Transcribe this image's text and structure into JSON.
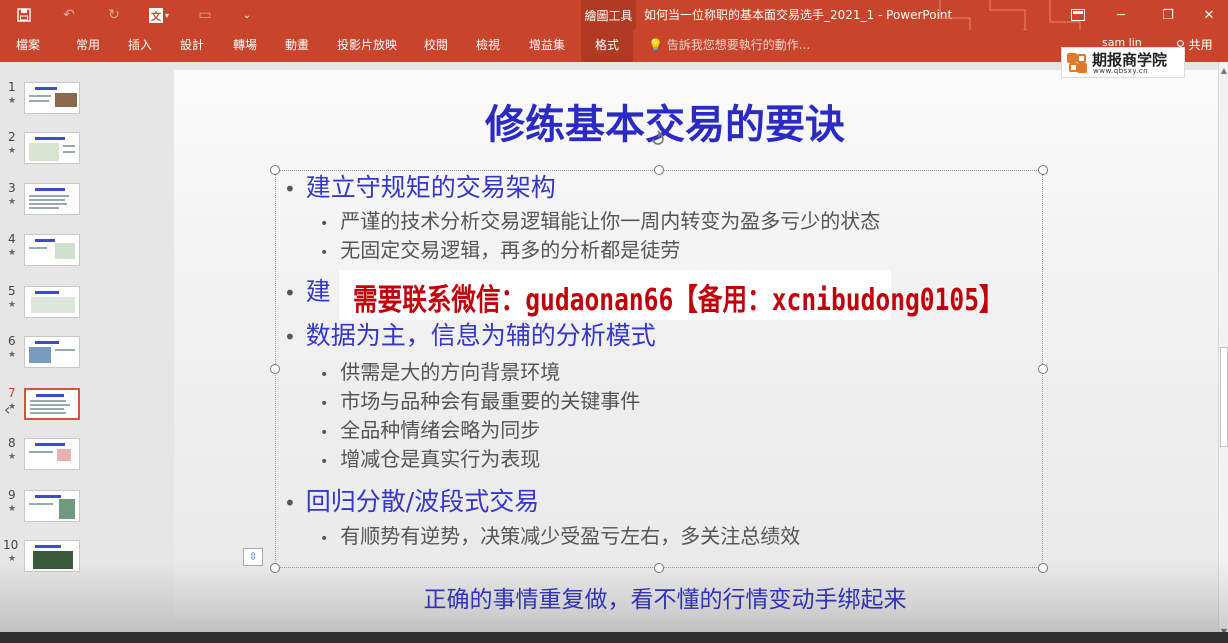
{
  "titlebar": {
    "quick_access": [
      {
        "name": "save-icon",
        "glyph": "🖫"
      },
      {
        "name": "undo-icon",
        "glyph": "↶"
      },
      {
        "name": "redo-icon",
        "glyph": "↻"
      },
      {
        "name": "language-icon",
        "glyph": "文"
      },
      {
        "name": "slideshow-start-icon",
        "glyph": "▭"
      },
      {
        "name": "customize-qat-icon",
        "glyph": "⌄"
      }
    ],
    "tool_context": "繪圖工具",
    "doc_title": "如何当一位称职的基本面交易选手_2021_1 - PowerPoint",
    "window_buttons": [
      {
        "name": "ribbon-display-options-icon",
        "glyph": "▣"
      },
      {
        "name": "minimize-icon",
        "glyph": "─"
      },
      {
        "name": "restore-icon",
        "glyph": "❐"
      },
      {
        "name": "close-icon",
        "glyph": "✕"
      }
    ]
  },
  "ribbon": {
    "tabs": [
      "檔案",
      "常用",
      "插入",
      "設計",
      "轉場",
      "動畫",
      "投影片放映",
      "校閱",
      "檢視",
      "增益集",
      "格式"
    ],
    "active_tab": "格式",
    "tell_me": "告訴我您想要執行的動作...",
    "user": "sam lin",
    "share": "共用"
  },
  "watermark": {
    "name": "期报商学院",
    "url": "www.qbsxy.cn"
  },
  "thumbnails": [
    {
      "num": "1",
      "star": "★"
    },
    {
      "num": "2",
      "star": "★"
    },
    {
      "num": "3",
      "star": "★"
    },
    {
      "num": "4",
      "star": "★"
    },
    {
      "num": "5",
      "star": "★"
    },
    {
      "num": "6",
      "star": "★"
    },
    {
      "num": "7",
      "star": "★",
      "selected": true
    },
    {
      "num": "8",
      "star": "★"
    },
    {
      "num": "9",
      "star": "★"
    },
    {
      "num": "10",
      "star": "★"
    }
  ],
  "slide": {
    "title": "修练基本交易的要诀",
    "bullets": {
      "b1": "建立守规矩的交易架构",
      "b1_1": "严谨的技术分析交易逻辑能让你一周内转变为盈多亏少的状态",
      "b1_2": "无固定交易逻辑，再多的分析都是徒劳",
      "b2_partial": "建",
      "b3": "数据为主，信息为辅的分析模式",
      "b3_1": "供需是大的方向背景环境",
      "b3_2": "市场与品种会有最重要的关键事件",
      "b3_3": "全品种情绪会略为同步",
      "b3_4": "增减仓是真实行为表现",
      "b4": "回归分散/波段式交易",
      "b4_1": "有顺势有逆势，决策减少受盈亏左右，多关注总绩效"
    },
    "overlay": "需要联系微信：gudaonan66【备用：xcnibudong0105】",
    "footer": "正确的事情重复做，看不懂的行情变动手绑起来",
    "bullet_glyph": "•"
  },
  "colors": {
    "titlebar": "#c8442b",
    "active_tab": "#b13a23",
    "slide_title": "#2b2bc4",
    "bullet_level1": "#3636c8",
    "bullet_level2": "#555555",
    "overlay_text": "#c0000a"
  }
}
